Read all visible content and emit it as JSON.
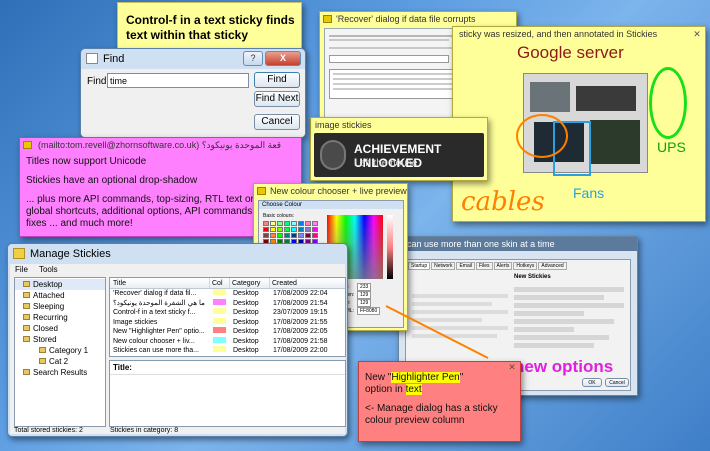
{
  "sticky_find_note": {
    "text": "Control-f in a text sticky finds text within that sticky"
  },
  "find_dialog": {
    "title": "Find",
    "help": "?",
    "close": "X",
    "label": "Find:",
    "value": "time",
    "find_btn": "Find",
    "find_next_btn": "Find Next",
    "cancel_btn": "Cancel"
  },
  "recover_sticky": {
    "title": "'Recover' dialog if data file corrupts"
  },
  "resized_sticky": {
    "title": "sticky was resized, and then annotated in Stickies",
    "heading": "Google server"
  },
  "resized_annotations": {
    "ups": "UPS",
    "cables": "cables",
    "fans": "Fans"
  },
  "image_stickies": {
    "title": "image stickies",
    "achievement_title": "ACHIEVEMENT UNLOCKED",
    "achievement_sub": "Left the house"
  },
  "unicode_sticky": {
    "title": "(mailto:tom.revell@zhornsoftware.co.uk) قعة الموحدة يونيكود؟",
    "line1": "Titles now support Unicode",
    "line2": "Stickies have an optional drop-shadow",
    "line3": "... plus more API commands, top-sizing, RTL text order, new global shortcuts, additional options, API commands, bug fixes ... and much more!"
  },
  "colour_chooser": {
    "sticky_title": "New colour chooser + live preview",
    "dialog_title": "Choose Colour",
    "basic_colours": "Basic colours:",
    "red_label": "Red:",
    "red": "233",
    "green_label": "Green:",
    "green": "129",
    "blue_label": "Blue:",
    "blue": "129",
    "html_label": "HTML:",
    "html": "FF8080",
    "swatches": [
      "#ff8080",
      "#ffff80",
      "#80ff80",
      "#00ff80",
      "#80ffff",
      "#0080ff",
      "#ff80c0",
      "#ff80ff",
      "#ff0000",
      "#ffff00",
      "#80ff00",
      "#00ff40",
      "#00ffff",
      "#0080c0",
      "#8080c0",
      "#ff00ff",
      "#804040",
      "#ff8040",
      "#00ff00",
      "#008080",
      "#004080",
      "#8080ff",
      "#800040",
      "#ff0080",
      "#800000",
      "#ff8000",
      "#008000",
      "#008040",
      "#0000ff",
      "#0000a0",
      "#800080",
      "#8000ff",
      "#400000",
      "#804000",
      "#004000",
      "#004040",
      "#000080",
      "#000040",
      "#400040",
      "#400080"
    ]
  },
  "skin_sticky": {
    "title": "can use more than one skin at a time",
    "overlay": "new options"
  },
  "options_dialog": {
    "tabs": [
      "Startup",
      "Network",
      "Email",
      "Files",
      "Alerts",
      "Hotkeys",
      "Advanced"
    ],
    "section_title": "New Stickies",
    "ok_btn": "OK",
    "cancel_btn": "Cancel"
  },
  "highlighter_sticky": {
    "line1_prefix": "New \"",
    "line1_highlight": "Highlighter Pen",
    "line1_suffix": "\"",
    "line2_prefix": "option in ",
    "line2_highlight": "text",
    "line3": "<- Manage dialog has a sticky colour preview column"
  },
  "manage": {
    "title": "Manage Stickies",
    "menu": [
      "File",
      "Tools"
    ],
    "tree": [
      {
        "label": "Desktop",
        "level": 1,
        "selected": true
      },
      {
        "label": "Attached",
        "level": 1
      },
      {
        "label": "Sleeping",
        "level": 1
      },
      {
        "label": "Recurring",
        "level": 1
      },
      {
        "label": "Closed",
        "level": 1
      },
      {
        "label": "Stored",
        "level": 1
      },
      {
        "label": "Category 1",
        "level": 2
      },
      {
        "label": "Cat 2",
        "level": 2
      },
      {
        "label": "Search Results",
        "level": 1
      }
    ],
    "columns": [
      "Title",
      "Col",
      "Category",
      "Created"
    ],
    "rows": [
      {
        "title": "'Recover' dialog if data fil...",
        "col": "#ffff99",
        "category": "Desktop",
        "created": "17/08/2009 22:04"
      },
      {
        "title": "ما هي الشفرة الموحدة يونيكود؟",
        "col": "#ff80ff",
        "category": "Desktop",
        "created": "17/08/2009 21:54"
      },
      {
        "title": "Control-f in a text sticky f...",
        "col": "#ffff99",
        "category": "Desktop",
        "created": "23/07/2009 19:15"
      },
      {
        "title": "Image stickies",
        "col": "#ffff99",
        "category": "Desktop",
        "created": "17/08/2009 21:55"
      },
      {
        "title": "New \"Highlighter Pen\" optio...",
        "col": "#ff8080",
        "category": "Desktop",
        "created": "17/08/2009 22:05"
      },
      {
        "title": "New colour chooser + liv...",
        "col": "#80ffff",
        "category": "Desktop",
        "created": "17/08/2009 21:58"
      },
      {
        "title": "Stickies can use more tha...",
        "col": "#ffff99",
        "category": "Desktop",
        "created": "17/08/2009 22:00"
      }
    ],
    "detail_label": "Title:",
    "status_left": "Total stored stickies: 2",
    "status_right": "Stickies in category: 8"
  }
}
